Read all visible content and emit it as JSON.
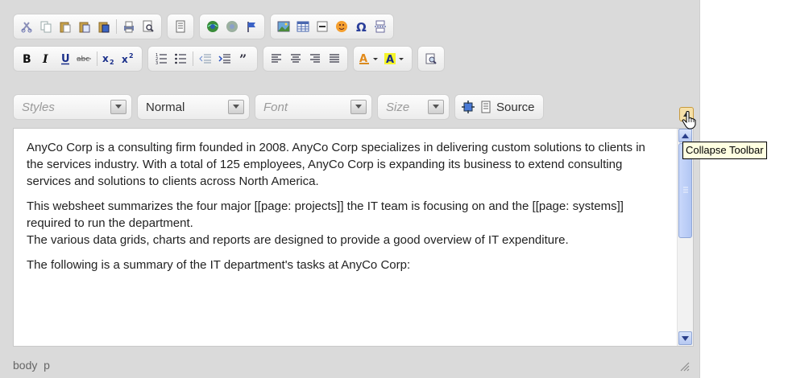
{
  "toolbar": {
    "row1_groups": [
      [
        "cut-icon",
        "copy-icon",
        "paste-icon",
        "paste-text-icon",
        "paste-word-icon",
        "|",
        "print-icon",
        "preview-icon"
      ],
      [
        "templates-icon"
      ],
      [
        "link-icon",
        "unlink-icon",
        "anchor-icon"
      ],
      [
        "image-icon",
        "table-icon",
        "horizontal-rule-icon",
        "smiley-icon",
        "special-char-icon",
        "page-break-icon"
      ]
    ],
    "combos": [
      {
        "name": "styles-combo",
        "label": "Styles"
      },
      {
        "name": "format-combo",
        "label": "Normal"
      },
      {
        "name": "font-combo",
        "label": "Font"
      },
      {
        "name": "size-combo",
        "label": "Size"
      }
    ],
    "source_label": "Source",
    "collapse_tooltip": "Collapse Toolbar"
  },
  "content": {
    "paragraphs": [
      "AnyCo Corp is a consulting firm founded in 2008. AnyCo Corp specializes in delivering custom solutions to clients in the services industry. With a total of 125 employees, AnyCo Corp is expanding its business to extend consulting services and solutions to clients across North America.",
      "This websheet summarizes the four major [[page: projects]] the IT team is focusing on and the [[page: systems]] required to run the department.",
      "The various data grids, charts and reports are designed to provide a good overview of IT expenditure.",
      "The following is a summary of the IT department's tasks at AnyCo Corp:"
    ]
  },
  "statusbar": {
    "path": "body  p"
  },
  "colors": {
    "editor_bg": "#dadada",
    "scroll_accent": "#b6c8f1",
    "tooltip_bg": "#ffffe1"
  }
}
